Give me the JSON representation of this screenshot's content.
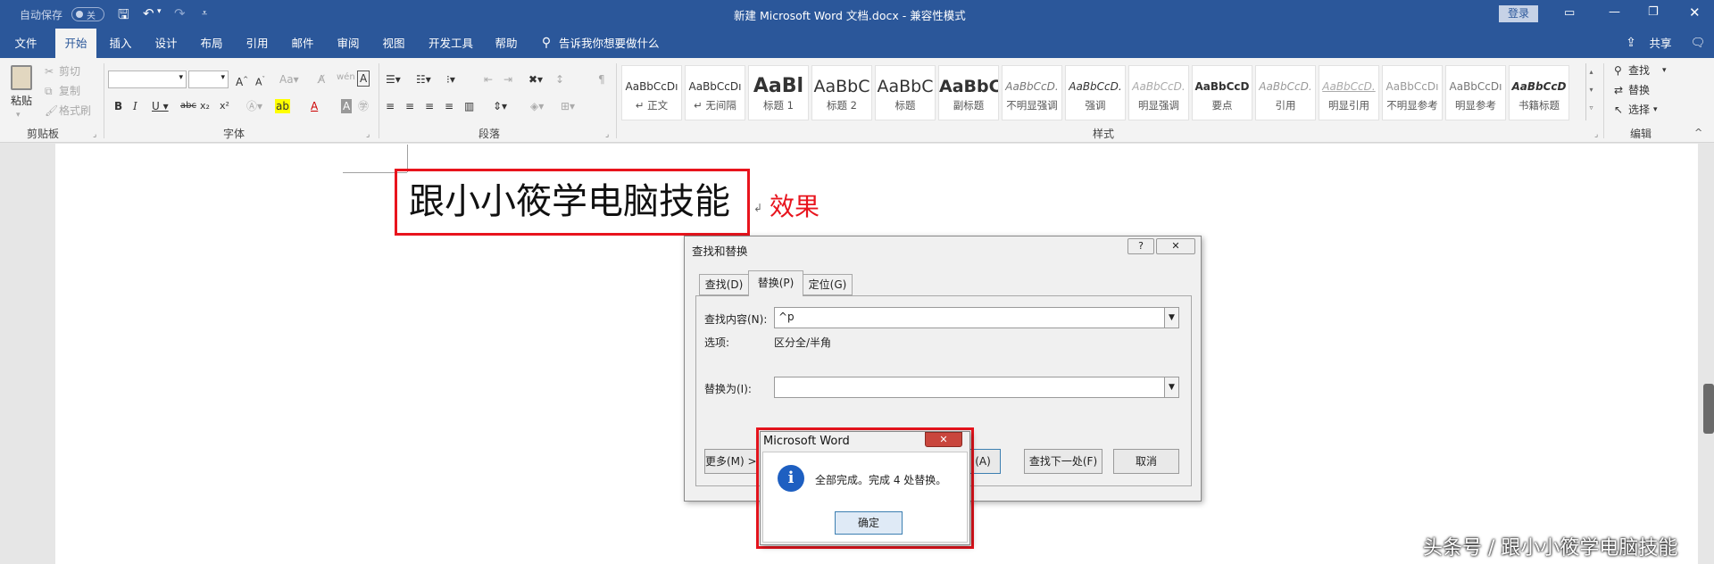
{
  "titlebar": {
    "autosave": "自动保存",
    "autosave_state": "关",
    "doc_title": "新建 Microsoft Word 文档.docx  -  兼容性模式",
    "login": "登录"
  },
  "tabs": [
    "文件",
    "开始",
    "插入",
    "设计",
    "布局",
    "引用",
    "邮件",
    "审阅",
    "视图",
    "开发工具",
    "帮助"
  ],
  "tell_me": "告诉我你想要做什么",
  "share": "共享",
  "ribbon": {
    "clipboard": {
      "paste": "粘贴",
      "cut": "剪切",
      "copy": "复制",
      "format_painter": "格式刷",
      "label": "剪贴板"
    },
    "font_label": "字体",
    "paragraph_label": "段落",
    "styles_label": "样式",
    "editing_label": "编辑",
    "styles": [
      {
        "preview": "AaBbCcDı",
        "name": "↵ 正文"
      },
      {
        "preview": "AaBbCcDı",
        "name": "↵ 无间隔"
      },
      {
        "preview": "AaBl",
        "name": "标题 1"
      },
      {
        "preview": "AaBbC",
        "name": "标题 2"
      },
      {
        "preview": "AaBbC",
        "name": "标题"
      },
      {
        "preview": "AaBbC",
        "name": "副标题"
      },
      {
        "preview": "AaBbCcD.",
        "name": "不明显强调"
      },
      {
        "preview": "AaBbCcD.",
        "name": "强调"
      },
      {
        "preview": "AaBbCcD.",
        "name": "明显强调"
      },
      {
        "preview": "AaBbCcD",
        "name": "要点"
      },
      {
        "preview": "AaBbCcD.",
        "name": "引用"
      },
      {
        "preview": "AaBbCcD.",
        "name": "明显引用"
      },
      {
        "preview": "AaBbCcDı",
        "name": "不明显参考"
      },
      {
        "preview": "AaBbCcDı",
        "name": "明显参考"
      },
      {
        "preview": "AaBbCcD",
        "name": "书籍标题"
      }
    ],
    "editing": {
      "find": "查找",
      "replace": "替换",
      "select": "选择"
    }
  },
  "document": {
    "main_text": "跟小小筱学电脑技能",
    "annotation": "效果"
  },
  "find_replace": {
    "title": "查找和替换",
    "tabs": [
      "查找(D)",
      "替换(P)",
      "定位(G)"
    ],
    "find_label": "查找内容(N):",
    "find_value": "^p",
    "options_label": "选项:",
    "options_value": "区分全/半角",
    "replace_label": "替换为(I):",
    "replace_value": "",
    "more_button": "更多(M) >>",
    "replace_all_tail": "(A)",
    "find_next_button": "查找下一处(F)",
    "cancel_button": "取消"
  },
  "msgbox": {
    "title": "Microsoft Word",
    "message": "全部完成。完成 4 处替换。",
    "ok_button": "确定"
  },
  "watermark": "头条号 / 跟小小筱学电脑技能",
  "colors": {
    "accent": "#2b579a",
    "highlight_red": "#e8141d"
  }
}
